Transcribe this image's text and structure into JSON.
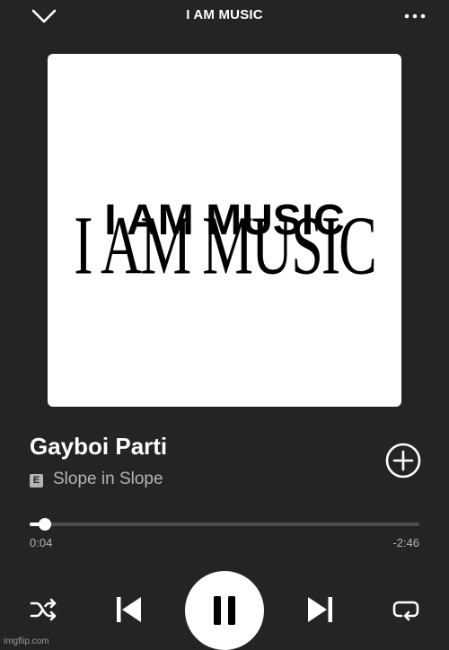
{
  "header": {
    "title": "I AM MUSIC",
    "collapse_icon": "chevron-down-icon",
    "more_icon": "more-dots-icon"
  },
  "artwork": {
    "serif_text": "I AM MUSIC",
    "bold_text": "I AM MUSIC"
  },
  "track": {
    "title": "Gayboi Parti",
    "explicit_badge": "E",
    "artist": "Slope in Slope"
  },
  "progress": {
    "fraction": 0.04,
    "elapsed": "0:04",
    "remaining": "-2:46"
  },
  "controls": {
    "shuffle_icon": "shuffle-icon",
    "previous_icon": "skip-previous-icon",
    "pause_icon": "pause-icon",
    "next_icon": "skip-next-icon",
    "repeat_icon": "repeat-icon",
    "add_icon": "add-circle-icon"
  },
  "watermark": "imgflip.com",
  "colors": {
    "background": "#242424",
    "text_primary": "#ffffff",
    "text_secondary": "#b3b3b3",
    "track_empty": "#4d4d4d"
  }
}
